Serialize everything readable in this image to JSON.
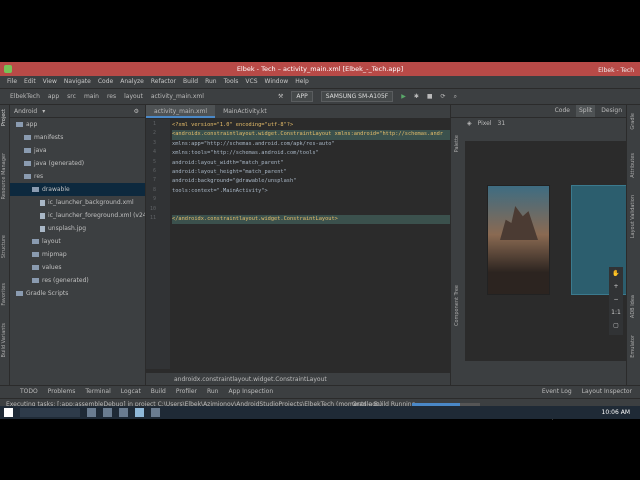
{
  "title_bar": {
    "title": "Elbek - Tech – activity_main.xml [Elbek_-_Tech.app]",
    "watermark": "Elbek - Tech"
  },
  "menu": [
    "File",
    "Edit",
    "View",
    "Navigate",
    "Code",
    "Analyze",
    "Refactor",
    "Build",
    "Run",
    "Tools",
    "VCS",
    "Window",
    "Help"
  ],
  "breadcrumbs": [
    "ElbekTech",
    "app",
    "src",
    "main",
    "res",
    "layout",
    "activity_main.xml"
  ],
  "toolbar": {
    "module": "APP",
    "device": "SAMSUNG SM-A105F"
  },
  "project": {
    "header": "Android",
    "items": [
      {
        "label": "app",
        "indent": 0
      },
      {
        "label": "manifests",
        "indent": 1
      },
      {
        "label": "java",
        "indent": 1
      },
      {
        "label": "java (generated)",
        "indent": 1
      },
      {
        "label": "res",
        "indent": 1
      },
      {
        "label": "drawable",
        "indent": 2
      },
      {
        "label": "ic_launcher_background.xml",
        "indent": 3
      },
      {
        "label": "ic_launcher_foreground.xml (v24)",
        "indent": 3
      },
      {
        "label": "unsplash.jpg",
        "indent": 3
      },
      {
        "label": "layout",
        "indent": 2
      },
      {
        "label": "mipmap",
        "indent": 2
      },
      {
        "label": "values",
        "indent": 2
      },
      {
        "label": "res (generated)",
        "indent": 2
      },
      {
        "label": "Gradle Scripts",
        "indent": 0
      }
    ]
  },
  "tabs": [
    "activity_main.xml",
    "MainActivity.kt"
  ],
  "code_lines": [
    "<?xml version=\"1.0\" encoding=\"utf-8\"?>",
    "<androidx.constraintlayout.widget.ConstraintLayout xmlns:android=\"http://schemas.andr",
    "    xmlns:app=\"http://schemas.android.com/apk/res-auto\"",
    "    xmlns:tools=\"http://schemas.android.com/tools\"",
    "    android:layout_width=\"match_parent\"",
    "    android:layout_height=\"match_parent\"",
    "    android:background=\"@drawable/unsplash\"",
    "    tools:context=\".MainActivity\">",
    "",
    "",
    "</androidx.constraintlayout.widget.ConstraintLayout>"
  ],
  "editor_footer": "androidx.constraintlayout.widget.ConstraintLayout",
  "design": {
    "modes": [
      "Code",
      "Split",
      "Design"
    ],
    "device": "Pixel",
    "api": "31",
    "zoom": "1:1"
  },
  "side_tabs": {
    "left": [
      "Project",
      "Resource Manager",
      "Structure",
      "Favorites",
      "Build Variants"
    ],
    "palette": "Palette",
    "tree": "Component Tree",
    "right": [
      "Gradle",
      "Attributes",
      "Layout Validation",
      "ADB Idea",
      "Emulator"
    ]
  },
  "bottom_tabs": [
    "TODO",
    "Problems",
    "Terminal",
    "Logcat",
    "Build",
    "Profiler",
    "Run",
    "App Inspection"
  ],
  "bottom_right": [
    "Event Log",
    "Layout Inspector"
  ],
  "status": {
    "text": "Executing tasks: [:app:assembleDebug] in project C:\\Users\\Elbek\\Azimjonov\\AndroidStudioProjects\\ElbekTech (moments ago)",
    "task": "Gradle Build Running",
    "position": "8:35",
    "line_sep": "LF",
    "encoding": "UTF-8",
    "indent": "4 spaces",
    "theme": "Darcula"
  },
  "clock": "10:06 AM",
  "colors": {
    "titlebar": "#b84a47",
    "editor_bg": "#2b2b2b",
    "panel_bg": "#3c3f41",
    "accent": "#4a88c7"
  }
}
